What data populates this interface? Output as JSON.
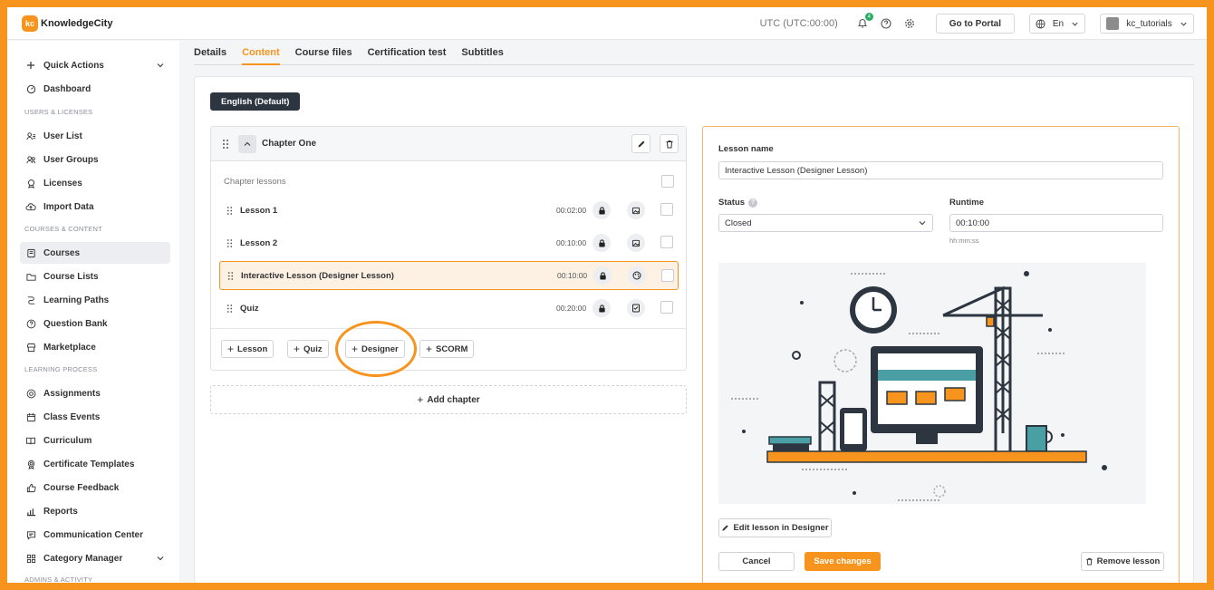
{
  "brand": {
    "logo_badge": "kc",
    "name": "KnowledgeCity",
    "accent": "#f7941d"
  },
  "topbar": {
    "timezone": "UTC (UTC:00:00)",
    "notif_count": "4",
    "portal_label": "Go to Portal",
    "language": "En",
    "username": "kc_tutorials"
  },
  "sidebar": {
    "quick_actions": "Quick Actions",
    "dashboard": "Dashboard",
    "sec_users": "USERS & LICENSES",
    "user_list": "User List",
    "user_groups": "User Groups",
    "licenses": "Licenses",
    "import_data": "Import Data",
    "sec_courses": "COURSES & CONTENT",
    "courses": "Courses",
    "course_lists": "Course Lists",
    "learning_paths": "Learning Paths",
    "question_bank": "Question Bank",
    "marketplace": "Marketplace",
    "sec_learning": "LEARNING PROCESS",
    "assignments": "Assignments",
    "class_events": "Class Events",
    "curriculum": "Curriculum",
    "certificate_templates": "Certificate Templates",
    "course_feedback": "Course Feedback",
    "reports": "Reports",
    "communication_center": "Communication Center",
    "category_manager": "Category Manager",
    "sec_admins": "ADMINS & ACTIVITY"
  },
  "tabs": [
    "Details",
    "Content",
    "Course files",
    "Certification test",
    "Subtitles"
  ],
  "content": {
    "language_button": "English (Default)",
    "chapter_title": "Chapter One",
    "chapter_lessons_label": "Chapter lessons",
    "lessons": [
      {
        "name": "Lesson 1",
        "time": "00:02:00"
      },
      {
        "name": "Lesson 2",
        "time": "00:10:00"
      },
      {
        "name": "Interactive Lesson (Designer Lesson)",
        "time": "00:10:00"
      },
      {
        "name": "Quiz",
        "time": "00:20:00"
      }
    ],
    "add_lesson": "Lesson",
    "add_quiz": "Quiz",
    "add_designer": "Designer",
    "add_scorm": "SCORM",
    "add_chapter": "Add chapter"
  },
  "panel": {
    "lesson_name_label": "Lesson name",
    "lesson_name_value": "Interactive Lesson  (Designer Lesson)",
    "status_label": "Status",
    "status_value": "Closed",
    "runtime_label": "Runtime",
    "runtime_value": "00:10:00",
    "runtime_hint": "hh:mm:ss",
    "edit_designer": "Edit lesson in Designer",
    "cancel": "Cancel",
    "save": "Save changes",
    "remove": "Remove lesson"
  }
}
